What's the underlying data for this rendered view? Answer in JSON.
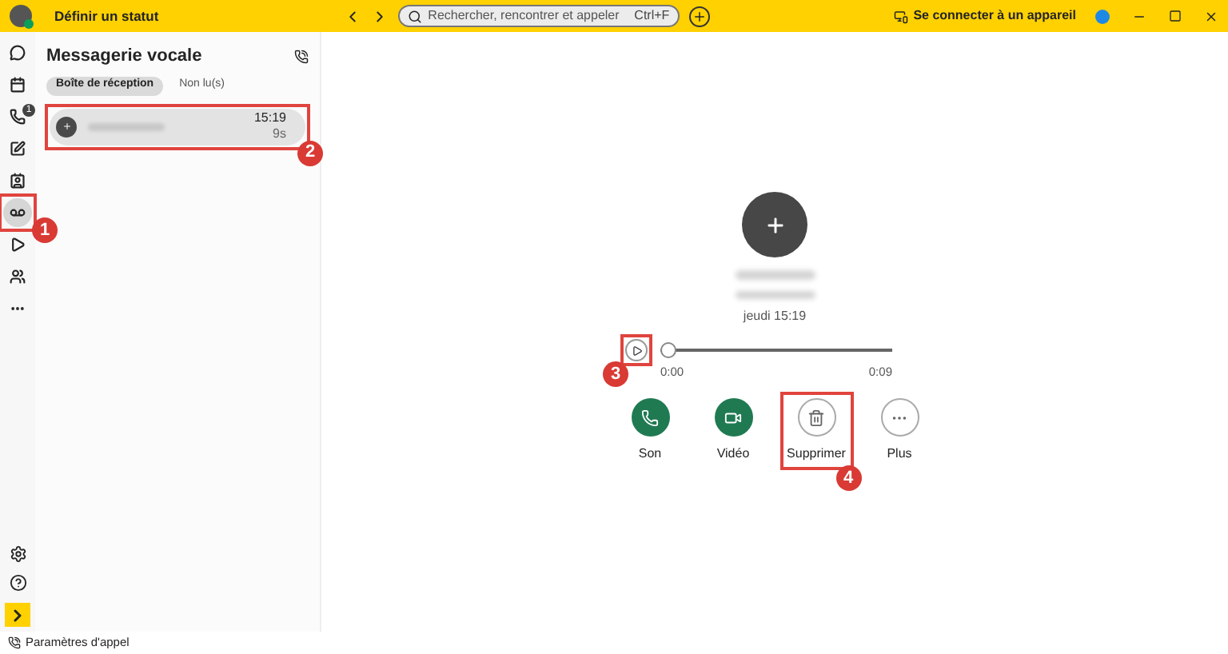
{
  "titlebar": {
    "status": "Définir un statut",
    "search_placeholder": "Rechercher, rencontrer et appeler",
    "shortcut": "Ctrl+F",
    "connect": "Se connecter à un appareil"
  },
  "rail": {
    "items": [
      {
        "kind": "chat",
        "selected": false
      },
      {
        "kind": "calendar",
        "selected": false
      },
      {
        "kind": "calls",
        "selected": false,
        "badge": "1"
      },
      {
        "kind": "meetings",
        "selected": false
      },
      {
        "kind": "contacts",
        "selected": false
      },
      {
        "kind": "voicemail",
        "selected": true,
        "callout": "1"
      },
      {
        "kind": "app",
        "selected": false
      },
      {
        "kind": "teams",
        "selected": false
      },
      {
        "kind": "more",
        "selected": false
      }
    ]
  },
  "list": {
    "title": "Messagerie vocale",
    "tabs": [
      {
        "label": "Boîte de réception",
        "selected": true
      },
      {
        "label": "Non lu(s)",
        "selected": false
      }
    ],
    "items": [
      {
        "time": "15:19",
        "duration": "9s",
        "selected": true,
        "callout": "2"
      }
    ]
  },
  "detail": {
    "date": "jeudi 15:19",
    "player": {
      "level": 0,
      "start": "0:00",
      "end": "0:09",
      "callout": "3"
    },
    "actions": [
      {
        "kind": "phone",
        "label": "Son",
        "filled": true
      },
      {
        "kind": "video",
        "label": "Vidéo",
        "filled": true
      },
      {
        "kind": "trash",
        "label": "Supprimer",
        "filled": false,
        "callout": "4"
      },
      {
        "kind": "more",
        "label": "Plus",
        "filled": false
      }
    ]
  },
  "footer": {
    "label": "Paramètres d'appel"
  }
}
